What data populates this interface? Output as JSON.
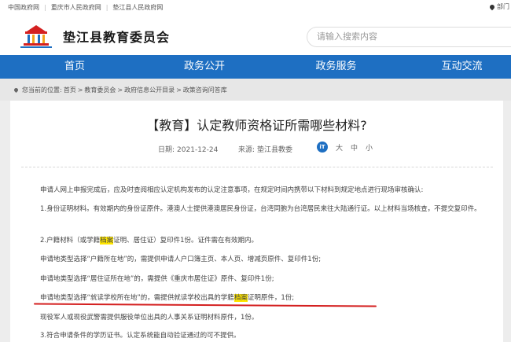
{
  "topbar": {
    "links": [
      "中国政府网",
      "重庆市人民政府网",
      "垫江县人民政府网"
    ],
    "right_label": "部门"
  },
  "header": {
    "title": "垫江县教育委员会",
    "search_placeholder": "请输入搜索内容"
  },
  "nav": {
    "items": [
      "首页",
      "政务公开",
      "政务服务",
      "互动交流"
    ]
  },
  "breadcrumb": {
    "prefix": "您当前的位置:",
    "items": [
      "首页",
      "教育委员会",
      "政府信息公开目录",
      "政策咨询问答库"
    ],
    "separator": ">"
  },
  "article": {
    "title": "【教育】认定教师资格证所需哪些材料?",
    "date_label": "日期:",
    "date": "2021-12-24",
    "source_label": "来源:",
    "source": "垫江县教委",
    "font_sizes": [
      "大",
      "中",
      "小"
    ],
    "font_icon": "iT",
    "intro": "申请人网上申报完成后，应及时查阅相应认定机构发布的认定注意事项，在规定时间内携带以下材料到规定地点进行现场审核确认:",
    "item1": "1.身份证明材料。有效期内的身份证原件。港澳人士提供港澳居民身份证，台湾同胞为台湾居民来往大陆通行证。以上材料当场核查，不提交复印件。",
    "item2_a": "2.户籍材料（或学籍",
    "item2_hl": "档案",
    "item2_b": "证明、居住证）复印件1份。证件需在有效期内。",
    "p3": "申请地类型选择“户籍所在地”的，需提供申请人户口簿主页、本人页、增减页原件、复印件1份;",
    "p4": "申请地类型选择“居住证所在地”的，需提供《重庆市居住证》原件、复印件1份;",
    "p5_a": "申请地类型选择“就读学校所在地”的，需提供就读学校出具的学籍",
    "p5_hl": "档案",
    "p5_b": "证明原件，1份;",
    "p6": "现役军人或现役武警需提供服役单位出具的人事关系证明材料原件，1份。",
    "item3": "3.符合申请条件的学历证书。认定系统能自动验证通过的可不提供。"
  }
}
